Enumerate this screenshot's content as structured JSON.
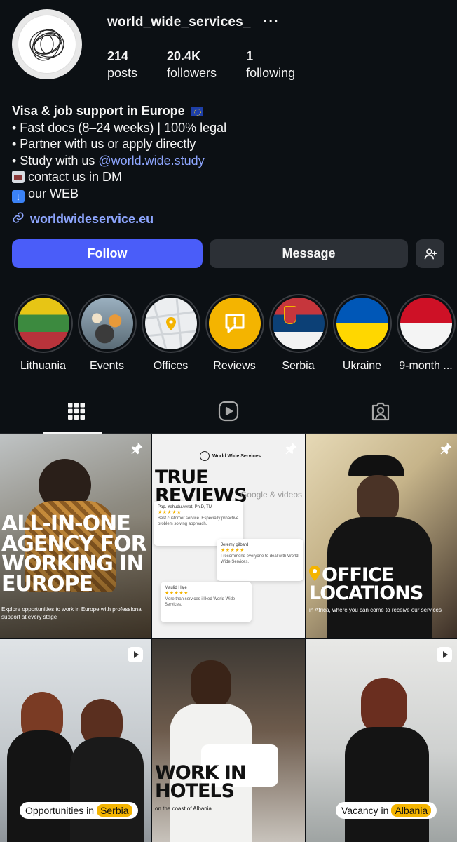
{
  "profile": {
    "username": "world_wide_services_",
    "more_icon": "ellipsis-icon",
    "stats": [
      {
        "value": "214",
        "label": "posts"
      },
      {
        "value": "20.4K",
        "label": "followers"
      },
      {
        "value": "1",
        "label": "following"
      }
    ]
  },
  "bio": {
    "title": "Visa & job support in Europe",
    "lines": [
      "• Fast docs (8–24 weeks) | 100% legal",
      "• Partner with us or apply directly",
      "• Study with us "
    ],
    "mention": "@world.wide.study",
    "contact": "contact us in DM",
    "web": "our WEB",
    "link": "worldwideservice.eu"
  },
  "buttons": {
    "follow": "Follow",
    "message": "Message",
    "suggest_icon": "add-person-icon"
  },
  "highlights": [
    {
      "label": "Lithuania"
    },
    {
      "label": "Events"
    },
    {
      "label": "Offices"
    },
    {
      "label": "Reviews"
    },
    {
      "label": "Serbia"
    },
    {
      "label": "Ukraine"
    },
    {
      "label": "9-month ..."
    }
  ],
  "tabs": [
    {
      "icon": "grid-icon",
      "active": true
    },
    {
      "icon": "reels-icon",
      "active": false
    },
    {
      "icon": "tagged-icon",
      "active": false
    }
  ],
  "posts": {
    "p1": {
      "headline_1": "ALL-IN-ONE",
      "headline_2": "AGENCY FOR",
      "headline_3": "WORKING IN",
      "headline_4": "EUROPE",
      "caption": "Explore opportunities to work in Europe with professional support at every stage"
    },
    "p2": {
      "brand": "World Wide Services",
      "headline": "TRUE REVIEWS",
      "sub": "Google & videos",
      "r1_name": "Pap. Yehudu Avrat, Ph.D, TM",
      "r1_text": "Best customer service. Especially proactive problem solving approach.",
      "r2_name": "Jeremy gilbard",
      "r2_text": "I recommend everyone to deal with World Wide Services.",
      "r3_name": "Maulid Haje",
      "r3_text": "More than services i liked World Wide Services."
    },
    "p3": {
      "headline_1": "OFFICE",
      "headline_2": "LOCATIONS",
      "caption": "in Africa, where you can come to receive our services"
    },
    "p4": {
      "pill_text": "Opportunities in",
      "pill_hl": "Serbia"
    },
    "p5": {
      "headline_1": "WORK IN",
      "headline_2": "HOTELS",
      "caption": "on the coast of Albania"
    },
    "p6": {
      "pill_text": "Vacancy in",
      "pill_hl": "Albania"
    }
  },
  "colors": {
    "background": "#0c1014",
    "follow_button": "#4a5df9",
    "secondary_button": "#2c3036",
    "link": "#8ea6ff"
  }
}
